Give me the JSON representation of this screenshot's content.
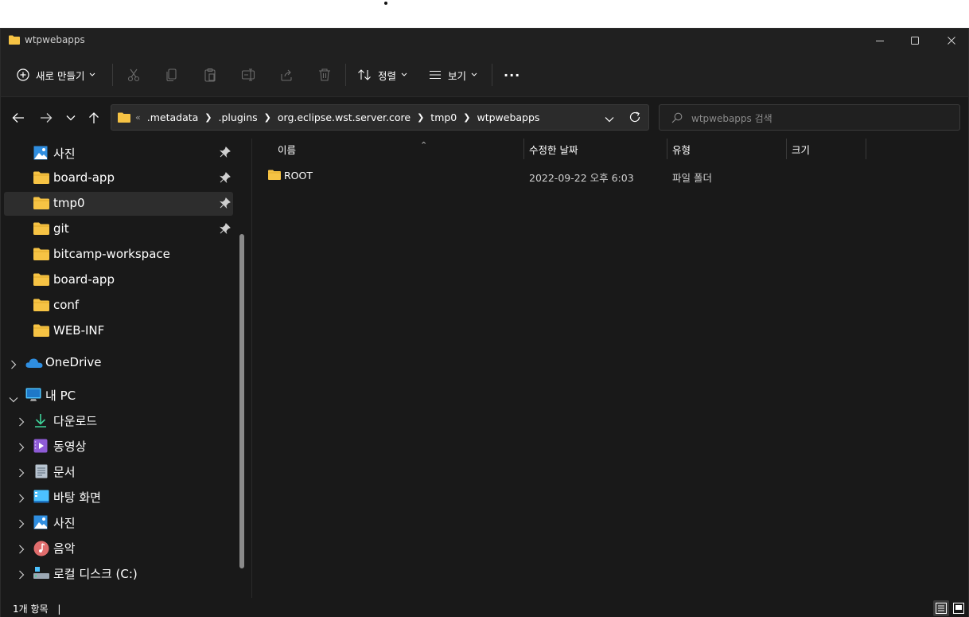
{
  "window": {
    "title": "wtpwebapps"
  },
  "toolbar": {
    "new_label": "새로 만들기",
    "sort_label": "정렬",
    "view_label": "보기",
    "more_label": "···"
  },
  "address": {
    "overflow": "«",
    "crumbs": [
      ".metadata",
      ".plugins",
      "org.eclipse.wst.server.core",
      "tmp0",
      "wtpwebapps"
    ]
  },
  "search": {
    "placeholder": "wtpwebapps 검색"
  },
  "sidebar": {
    "quick_access": [
      {
        "label": "사진",
        "icon": "pictures-icon",
        "pinned": true
      },
      {
        "label": "board-app",
        "icon": "folder-icon",
        "pinned": true
      },
      {
        "label": "tmp0",
        "icon": "folder-icon",
        "pinned": true,
        "selected": true
      },
      {
        "label": "git",
        "icon": "folder-icon",
        "pinned": true
      },
      {
        "label": "bitcamp-workspace",
        "icon": "folder-icon",
        "pinned": false
      },
      {
        "label": "board-app",
        "icon": "folder-icon",
        "pinned": false
      },
      {
        "label": "conf",
        "icon": "folder-icon",
        "pinned": false
      },
      {
        "label": "WEB-INF",
        "icon": "folder-icon",
        "pinned": false
      }
    ],
    "onedrive_label": "OneDrive",
    "this_pc_label": "내 PC",
    "this_pc_items": [
      {
        "label": "다운로드",
        "icon": "downloads-icon"
      },
      {
        "label": "동영상",
        "icon": "videos-icon"
      },
      {
        "label": "문서",
        "icon": "documents-icon"
      },
      {
        "label": "바탕 화면",
        "icon": "desktop-icon"
      },
      {
        "label": "사진",
        "icon": "pictures-icon"
      },
      {
        "label": "음악",
        "icon": "music-icon"
      },
      {
        "label": "로컬 디스크 (C:)",
        "icon": "drive-icon"
      }
    ]
  },
  "columns": {
    "name": "이름",
    "modified": "수정한 날짜",
    "type": "유형",
    "size": "크기"
  },
  "files": [
    {
      "name": "ROOT",
      "modified": "2022-09-22 오후 6:03",
      "type": "파일 폴더",
      "size": ""
    }
  ],
  "status": {
    "item_count": "1개 항목",
    "cursor": "|"
  },
  "colors": {
    "background": "#191919",
    "folder": "#f6c344",
    "accent": "#4cc2ff"
  }
}
